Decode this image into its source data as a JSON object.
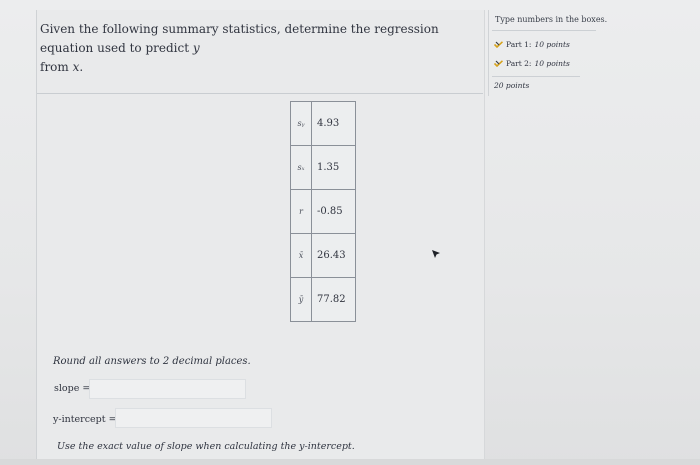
{
  "question": {
    "prefix": "Given the following summary statistics, determine the regression equation used to predict",
    "predict_var": "y",
    "from_word": "from",
    "from_var": "x",
    "end": "."
  },
  "side_panel": {
    "header": "Type numbers in the boxes.",
    "parts": [
      {
        "label": "Part 1:",
        "points": "10 points"
      },
      {
        "label": "Part 2:",
        "points": "10 points"
      }
    ],
    "total": "20 points",
    "icon": "partial-credit-icon"
  },
  "stats_table": {
    "rows": [
      {
        "symbol": "sᵧ",
        "value": "4.93"
      },
      {
        "symbol": "sₓ",
        "value": "1.35"
      },
      {
        "symbol": "r",
        "value": "-0.85"
      },
      {
        "symbol": "x̄",
        "value": "26.43"
      },
      {
        "symbol": "ȳ",
        "value": "77.82"
      }
    ]
  },
  "instructions": {
    "round": "Round all answers to 2 decimal places.",
    "slope_label": "slope =",
    "slope_value": "",
    "intercept_label": "y-intercept =",
    "intercept_value": "",
    "exact": "Use the exact value of slope when calculating the y-intercept."
  },
  "colors": {
    "background": "#e7e8e9",
    "text": "#2b2f3a",
    "table_border": "#8a9098",
    "icon_accent": "#d6a21a"
  }
}
